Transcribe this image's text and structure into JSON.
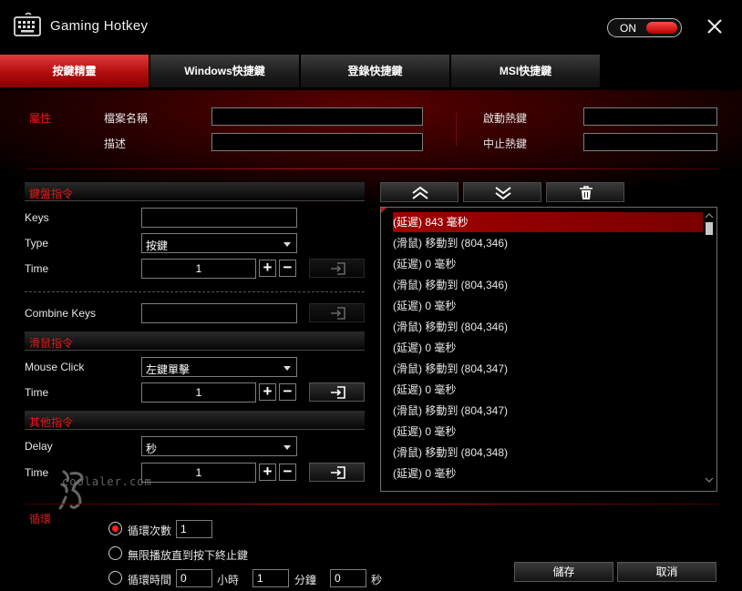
{
  "window": {
    "title": "Gaming Hotkey",
    "toggle_label": "ON",
    "toggle_state": "on"
  },
  "tabs": [
    {
      "label": "按鍵精靈",
      "active": true
    },
    {
      "label": "Windows快捷鍵",
      "active": false
    },
    {
      "label": "登錄快捷鍵",
      "active": false
    },
    {
      "label": "MSI快捷鍵",
      "active": false
    }
  ],
  "properties": {
    "section_label": "屬性",
    "file_name_label": "檔案名稱",
    "file_name_value": "",
    "description_label": "描述",
    "description_value": "",
    "start_hotkey_label": "啟動熱鍵",
    "start_hotkey_value": "",
    "stop_hotkey_label": "中止熱鍵",
    "stop_hotkey_value": ""
  },
  "keyboard": {
    "section_label": "鍵盤指令",
    "keys_label": "Keys",
    "keys_value": "",
    "type_label": "Type",
    "type_value": "按鍵",
    "time_label": "Time",
    "time_value": "1",
    "combine_label": "Combine Keys",
    "combine_value": ""
  },
  "mouse": {
    "section_label": "滑鼠指令",
    "click_label": "Mouse Click",
    "click_value": "左鍵單擊",
    "time_label": "Time",
    "time_value": "1"
  },
  "other": {
    "section_label": "其他指令",
    "delay_label": "Delay",
    "delay_value": "秒",
    "time_label": "Time",
    "time_value": "1"
  },
  "list_tools": {
    "up_icon": "double-chevron-up-icon",
    "down_icon": "double-chevron-down-icon",
    "delete_icon": "trash-icon"
  },
  "command_list": [
    {
      "text": "(延遲) 843 毫秒",
      "selected": true
    },
    {
      "text": "(滑鼠) 移動到 (804,346)",
      "selected": false
    },
    {
      "text": "(延遲) 0 毫秒",
      "selected": false
    },
    {
      "text": "(滑鼠) 移動到 (804,346)",
      "selected": false
    },
    {
      "text": "(延遲) 0 毫秒",
      "selected": false
    },
    {
      "text": "(滑鼠) 移動到 (804,346)",
      "selected": false
    },
    {
      "text": "(延遲) 0 毫秒",
      "selected": false
    },
    {
      "text": "(滑鼠) 移動到 (804,347)",
      "selected": false
    },
    {
      "text": "(延遲) 0 毫秒",
      "selected": false
    },
    {
      "text": "(滑鼠) 移動到 (804,347)",
      "selected": false
    },
    {
      "text": "(延遲) 0 毫秒",
      "selected": false
    },
    {
      "text": "(滑鼠) 移動到 (804,348)",
      "selected": false
    },
    {
      "text": "(延遲) 0 毫秒",
      "selected": false
    }
  ],
  "loop": {
    "section_label": "循環",
    "count_label": "循環次數",
    "count_value": "1",
    "until_label": "無限播放直到按下終止鍵",
    "time_label": "循環時間",
    "hours_value": "0",
    "hours_unit": "小時",
    "minutes_value": "1",
    "minutes_unit": "分鐘",
    "seconds_value": "0",
    "seconds_unit": "秒",
    "selected_option": "count"
  },
  "footer": {
    "save_label": "儲存",
    "cancel_label": "取消"
  },
  "watermark": {
    "text": "coolaler.com"
  },
  "colors": {
    "accent": "#e31b1b",
    "tab_active": "#c01818",
    "selection": "#a00000"
  }
}
